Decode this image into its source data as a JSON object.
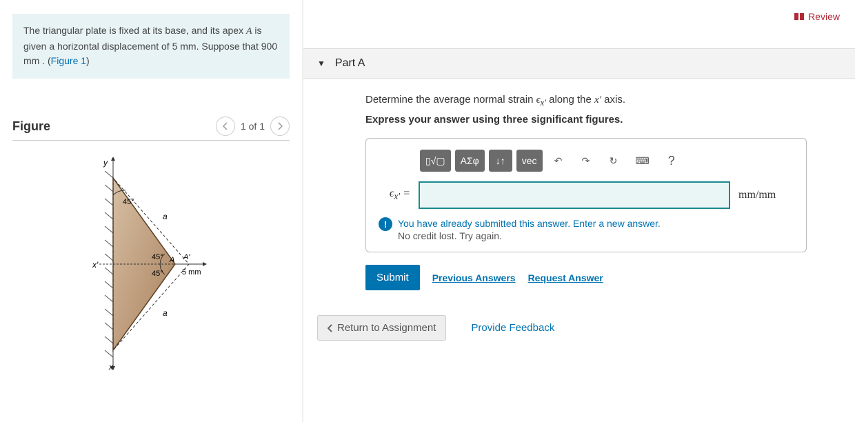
{
  "review_label": "Review",
  "prompt": {
    "text_start": "The triangular plate is fixed at its base, and its apex ",
    "apex_var": "A",
    "text_mid": " is given a horizontal displacement of 5 ",
    "unit1": "mm",
    "text_cont": ". Suppose that 900 ",
    "unit2": "mm",
    "text_end": " . (",
    "figure_link": "Figure 1",
    "close": ")"
  },
  "figure": {
    "heading": "Figure",
    "pager": "1 of 1",
    "labels": {
      "y": "y",
      "x": "x",
      "xprime": "x′",
      "a1": "a",
      "a2": "a",
      "angle45_top": "45°",
      "angle45_mid1": "45°",
      "angle45_mid2": "45°",
      "A": "A",
      "Aprime": "A′",
      "disp": "5 mm"
    }
  },
  "part": {
    "label": "Part A",
    "instruction_pre": "Determine the average normal strain ",
    "symbol": "ϵ",
    "sub": "x′",
    "instruction_mid": " along the ",
    "axis": "x′",
    "instruction_post": " axis.",
    "instruction2": "Express your answer using three significant figures."
  },
  "toolbar": {
    "templates": "▯√▢",
    "greek": "ΑΣφ",
    "updown": "↓↑",
    "vec": "vec",
    "undo": "↶",
    "redo": "↷",
    "reset": "↻",
    "keyboard": "⌨",
    "help": "?"
  },
  "answer": {
    "lhs_symbol": "ϵ",
    "lhs_sub": "x′",
    "equals": " =",
    "value": "",
    "units": "mm/mm"
  },
  "feedback": {
    "icon": "!",
    "line1": "You have already submitted this answer. Enter a new answer.",
    "line2": "No credit lost. Try again."
  },
  "actions": {
    "submit": "Submit",
    "previous": "Previous Answers",
    "request": "Request Answer",
    "return": "Return to Assignment",
    "provide": "Provide Feedback"
  }
}
